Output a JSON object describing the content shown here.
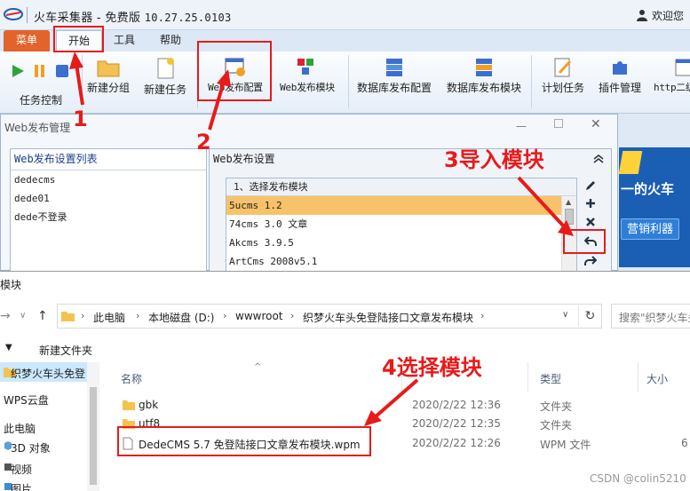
{
  "app": {
    "title": "火车采集器 - 免费版",
    "version": "10.27.25.0103",
    "welcome": "欢迎您",
    "tabs": [
      "菜单",
      "开始",
      "工具",
      "帮助"
    ],
    "ribbon": [
      "新建分组",
      "新建任务",
      "Web发布配置",
      "Web发布模块",
      "数据库发布配置",
      "数据库发布模块",
      "计划任务",
      "插件管理",
      "http二级"
    ],
    "task_group_label": "任务控制"
  },
  "dialog": {
    "title": "Web发布管理",
    "left_header": "Web发布设置列表",
    "left_items": [
      "dedecms",
      "dede01",
      "dede不登录"
    ],
    "right_header": "Web发布设置",
    "module_header": "1、选择发布模块",
    "modules": [
      "5ucms 1.2",
      "74cms 3.0 文章",
      "Akcms 3.9.5",
      "ArtCms 2008v5.1"
    ],
    "selected_module": 0
  },
  "banner": {
    "text": "一的火车",
    "button": "营销利器"
  },
  "explorer": {
    "title": "模块",
    "breadcrumb": [
      "此电脑",
      "本地磁盘 (D:)",
      "wwwroot",
      "织梦火车头免登陆接口文章发布模块"
    ],
    "search_placeholder": "搜索\"织梦火车头",
    "toolbar": {
      "new_folder": "新建文件夹"
    },
    "nav": [
      "织梦火车头免登",
      "WPS云盘",
      "此电脑",
      "3D 对象",
      "视频",
      "图片"
    ],
    "columns": {
      "name": "名称",
      "date": "",
      "type": "类型",
      "size": "大小"
    },
    "files": [
      {
        "name": "gbk",
        "date": "2020/2/22 12:36",
        "type": "文件夹",
        "size": "",
        "kind": "folder"
      },
      {
        "name": "utf8",
        "date": "2020/2/22 12:35",
        "type": "文件夹",
        "size": "",
        "kind": "folder"
      },
      {
        "name": "DedeCMS 5.7 免登陆接口文章发布模块.wpm",
        "date": "2020/2/22 12:26",
        "type": "WPM 文件",
        "size": "6",
        "kind": "file"
      }
    ]
  },
  "annotations": {
    "step1": "1",
    "step2": "2",
    "step3": "3导入模块",
    "step4": "4选择模块",
    "color": "#e81a1a"
  },
  "watermark": "CSDN @colin5210"
}
